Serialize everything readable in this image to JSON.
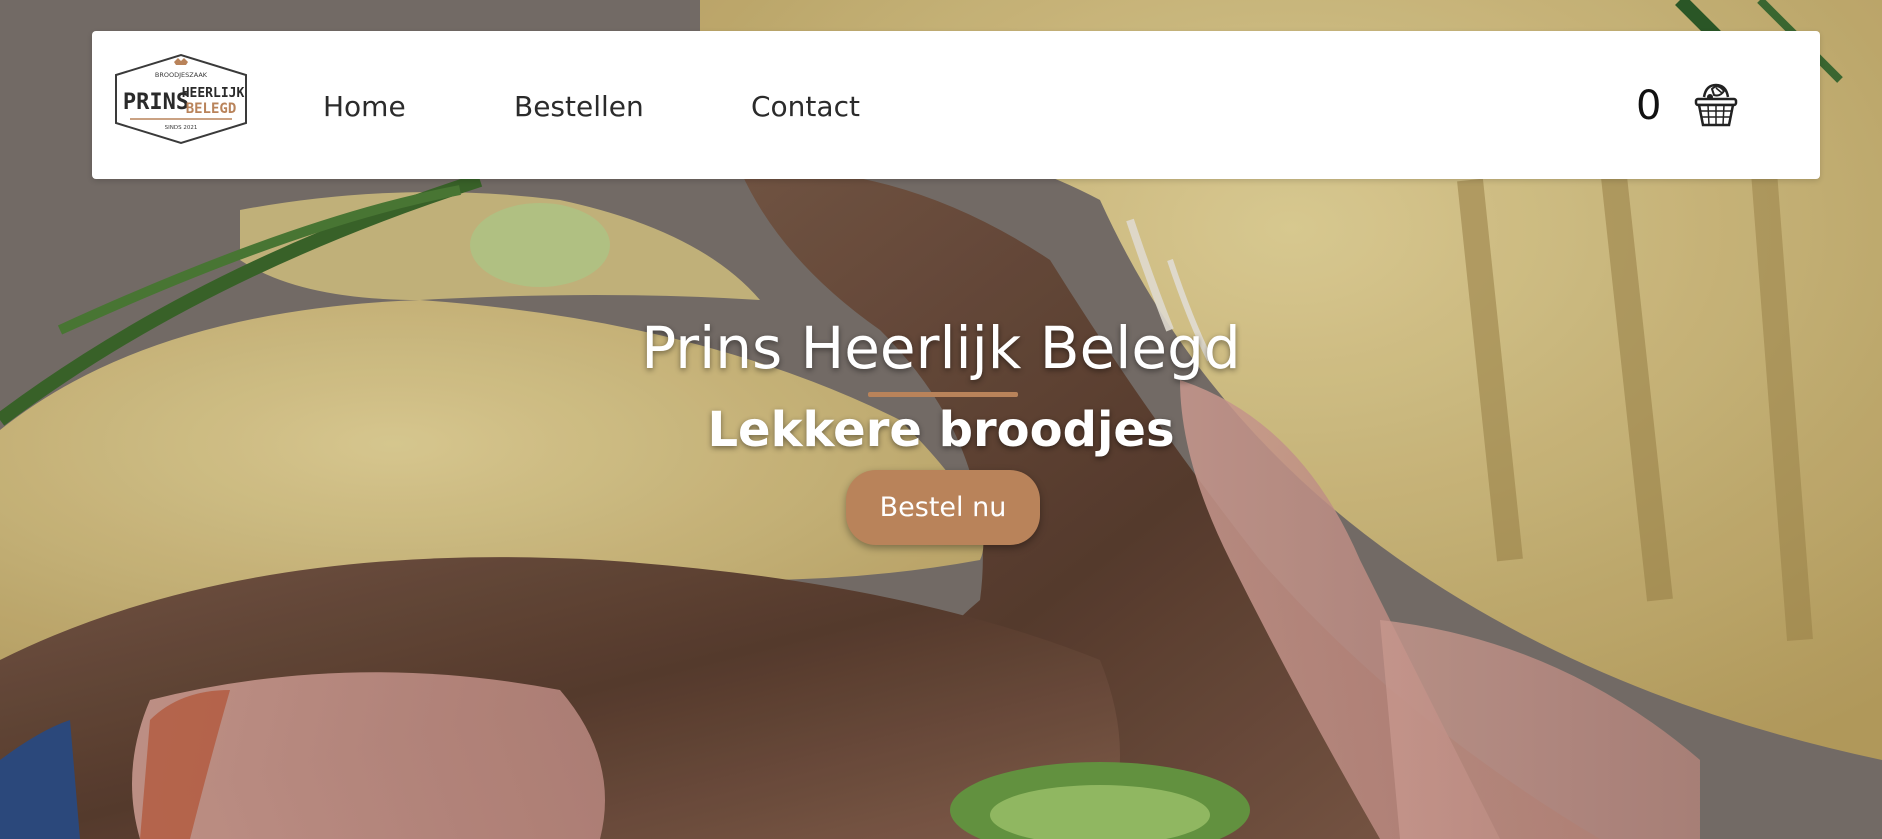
{
  "nav": {
    "logo": {
      "top_text": "BROODJESZAAK",
      "main_left": "PRINS",
      "main_right_top": "HEERLIJK",
      "main_right_bottom": "BELEGD",
      "since": "SINDS 2021"
    },
    "links": [
      {
        "label": "Home"
      },
      {
        "label": "Bestellen"
      },
      {
        "label": "Contact"
      }
    ],
    "cart_count": "0",
    "cart_icon": "basket-icon"
  },
  "hero": {
    "title": "Prins Heerlijk Belegd",
    "subtitle": "Lekkere broodjes",
    "cta_label": "Bestel nu",
    "background": "sandwich-photo"
  },
  "colors": {
    "accent": "#b9835a",
    "navbar_bg": "#ffffff",
    "text_dark": "#2b2b2b"
  }
}
